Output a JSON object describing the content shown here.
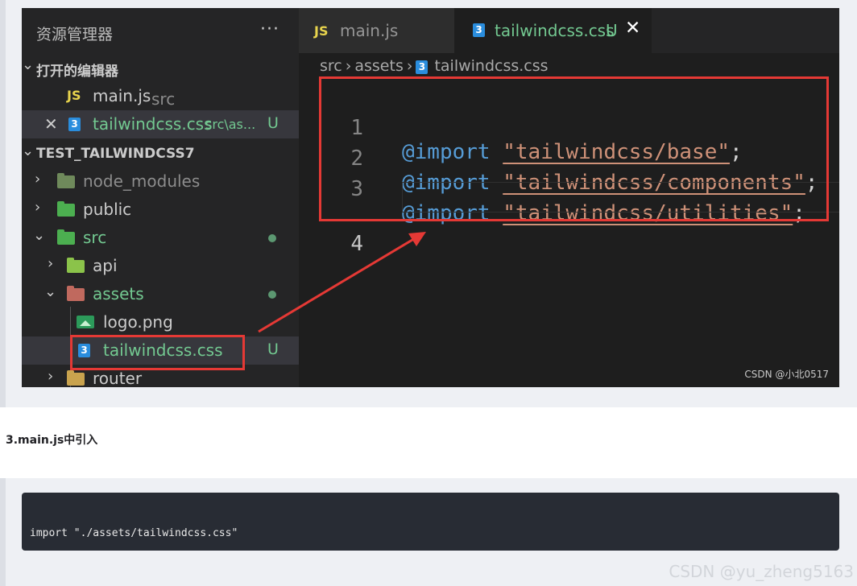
{
  "explorer": {
    "title": "资源管理器",
    "more": "···",
    "open_editors_label": "打开的编辑器",
    "open_editors": [
      {
        "name": "main.js",
        "path": "src"
      },
      {
        "name": "tailwindcss.css",
        "path": "src\\as...",
        "status": "U"
      }
    ],
    "project_label": "TEST_TAILWINDCSS7",
    "tree": {
      "node_modules": "node_modules",
      "public": "public",
      "src": "src",
      "api": "api",
      "assets": "assets",
      "logo": "logo.png",
      "css_file": "tailwindcss.css",
      "css_status": "U",
      "router": "router"
    }
  },
  "tabs": [
    {
      "label": "main.js",
      "badge": "JS"
    },
    {
      "label": "tailwindcss.css",
      "status": "U"
    }
  ],
  "breadcrumb": [
    "src",
    "assets",
    "tailwindcss.css"
  ],
  "code": {
    "lines": [
      {
        "num": "1",
        "kw": "@import",
        "str": "\"tailwindcss/base\"",
        "end": ";"
      },
      {
        "num": "2",
        "kw": "@import",
        "str": "\"tailwindcss/components\"",
        "end": ";"
      },
      {
        "num": "3",
        "kw": "@import",
        "str": "\"tailwindcss/utilities\"",
        "end": ";"
      },
      {
        "num": "4",
        "kw": "",
        "str": "",
        "end": ""
      }
    ]
  },
  "image_watermark": "CSDN @小北0517",
  "article": {
    "heading": "3.main.js中引入",
    "code": "import \"./assets/tailwindcss.css\"",
    "watermark": "CSDN @yu_zheng5163"
  },
  "colors": {
    "highlight_box": "#e53935",
    "css_icon": "#2a8ddd",
    "js_badge": "#e8d44d",
    "untracked": "#73c991"
  },
  "icons": {
    "css_file": "css3-icon",
    "js_file": "js-icon",
    "image_file": "image-icon",
    "folder": "folder-icon",
    "close": "close-icon",
    "chevron": "chevron-icon"
  }
}
